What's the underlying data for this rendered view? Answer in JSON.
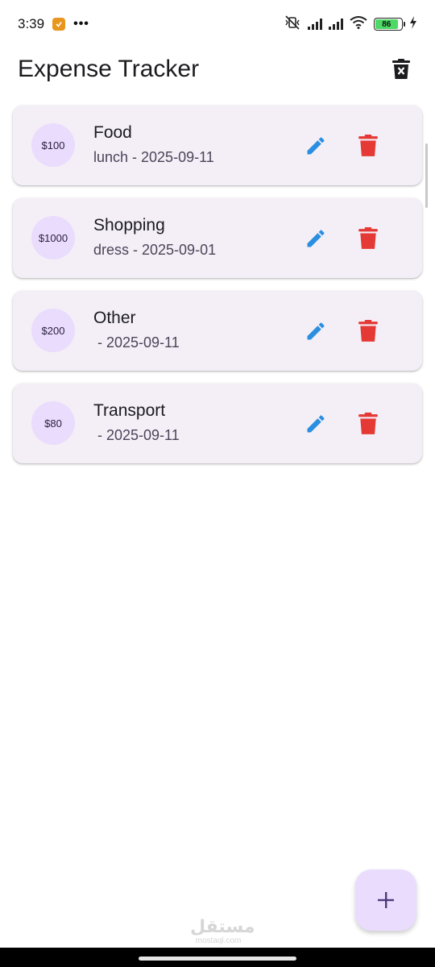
{
  "status_bar": {
    "time": "3:39",
    "dots": "•••",
    "battery": "86"
  },
  "app_bar": {
    "title": "Expense Tracker"
  },
  "expenses": [
    {
      "amount": "$100",
      "category": "Food",
      "subtitle": "lunch - 2025-09-11"
    },
    {
      "amount": "$1000",
      "category": "Shopping",
      "subtitle": "dress - 2025-09-01"
    },
    {
      "amount": "$200",
      "category": "Other",
      "subtitle": " - 2025-09-11"
    },
    {
      "amount": "$80",
      "category": "Transport",
      "subtitle": " - 2025-09-11"
    }
  ],
  "watermark": {
    "logo": "مستقل",
    "sub": "mostaql.com"
  },
  "colors": {
    "edit": "#2a8fe0",
    "delete": "#e53935",
    "card_bg": "#f4eff7",
    "avatar_bg": "#eadcfc",
    "fab_bg": "#eadcfc"
  },
  "icons": {
    "clear_all": "delete-forever-icon",
    "edit": "pencil-icon",
    "delete": "trash-icon",
    "add": "plus-icon"
  }
}
